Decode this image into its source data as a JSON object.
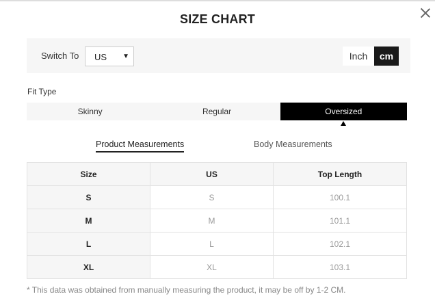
{
  "modal": {
    "title": "SIZE CHART",
    "close_icon": "close-icon"
  },
  "switch": {
    "label": "Switch To",
    "select_value": "US",
    "caret": "▼",
    "units": [
      "Inch",
      "cm"
    ],
    "active_unit": "cm"
  },
  "fit": {
    "label": "Fit Type",
    "options": [
      "Skinny",
      "Regular",
      "Oversized"
    ],
    "active": "Oversized"
  },
  "measurement_tabs": {
    "product": "Product Measurements",
    "body": "Body Measurements",
    "active": "product"
  },
  "table": {
    "headers": [
      "Size",
      "US",
      "Top Length"
    ],
    "rows": [
      [
        "S",
        "S",
        "100.1"
      ],
      [
        "M",
        "M",
        "101.1"
      ],
      [
        "L",
        "L",
        "102.1"
      ],
      [
        "XL",
        "XL",
        "103.1"
      ]
    ]
  },
  "note": "* This data was obtained from manually measuring the product, it may be off by 1-2 CM.",
  "colors": {
    "active_bg": "#000000",
    "panel_bg": "#f6f6f6",
    "muted_text": "#999999"
  }
}
